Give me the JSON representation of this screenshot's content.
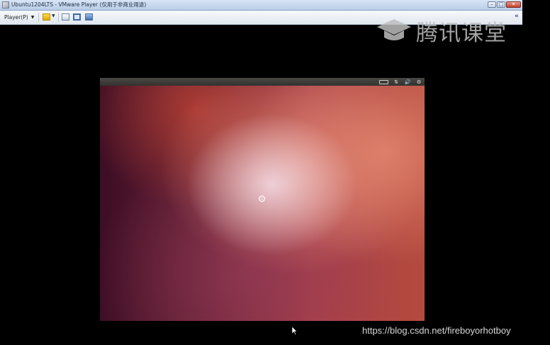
{
  "window": {
    "title": "Ubuntu1204LTS - VMware Player (仅用于非商业用途)",
    "minimize_label": "–",
    "maximize_label": "□",
    "close_label": "✕"
  },
  "toolbar": {
    "player_menu_label": "Player(P)",
    "caret": "▼",
    "collapse": "«"
  },
  "watermark": {
    "brand_text": "腾讯课堂",
    "url_text": "https://blog.csdn.net/fireboyorhotboy"
  },
  "vm": {
    "panel_icons": [
      "keyboard-icon",
      "network-icon",
      "volume-icon",
      "settings-gear-icon"
    ],
    "network_glyph": "⇅",
    "volume_glyph": "🔊",
    "gear_glyph": "⚙"
  },
  "colors": {
    "titlebar": "#c7d8ef",
    "desktop_highlight": "#f5e1eb",
    "desktop_base": "#6b2438"
  }
}
